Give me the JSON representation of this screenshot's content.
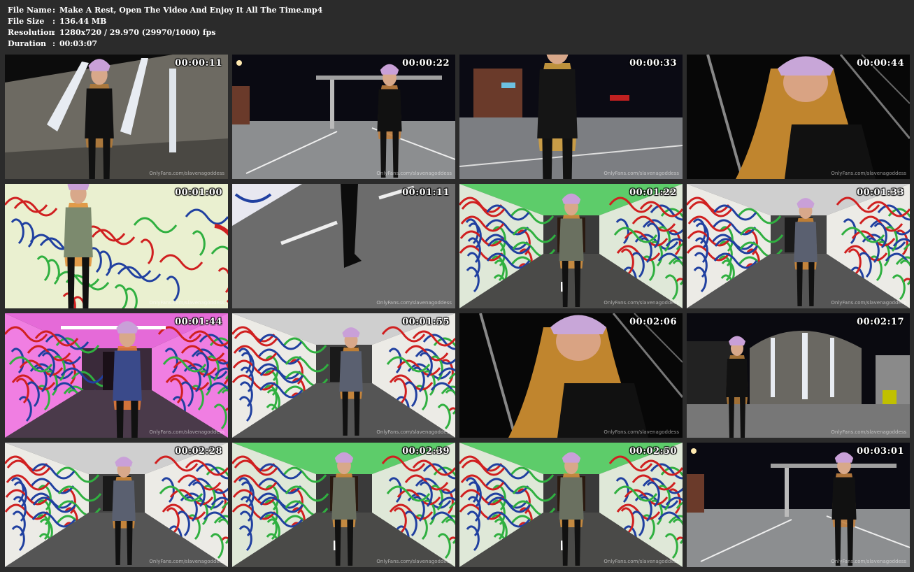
{
  "file_info": {
    "file_name_label": "File Name",
    "file_name": "Make A Rest, Open The Video And Enjoy It All The Time.mp4",
    "file_size_label": "File Size",
    "file_size": "136.44 MB",
    "resolution_label": "Resolution",
    "resolution": "1280x720 / 29.970 (29970/1000) fps",
    "duration_label": "Duration",
    "duration": "00:03:07",
    "separator": ":"
  },
  "watermark": "OnlyFans.com/slavenagoddess",
  "thumbnails": [
    {
      "time": "00:00:11",
      "scene": "night-building"
    },
    {
      "time": "00:00:22",
      "scene": "night-parking"
    },
    {
      "time": "00:00:33",
      "scene": "night-parking-blur"
    },
    {
      "time": "00:00:44",
      "scene": "night-closeup"
    },
    {
      "time": "00:01:00",
      "scene": "graffiti-wall"
    },
    {
      "time": "00:01:11",
      "scene": "boots-road"
    },
    {
      "time": "00:01:22",
      "scene": "tunnel-green"
    },
    {
      "time": "00:01:33",
      "scene": "tunnel-white"
    },
    {
      "time": "00:01:44",
      "scene": "tunnel-pink"
    },
    {
      "time": "00:01:55",
      "scene": "tunnel-white"
    },
    {
      "time": "00:02:06",
      "scene": "night-closeup"
    },
    {
      "time": "00:02:17",
      "scene": "night-building-round"
    },
    {
      "time": "00:02:28",
      "scene": "tunnel-white"
    },
    {
      "time": "00:02:39",
      "scene": "tunnel-green"
    },
    {
      "time": "00:02:50",
      "scene": "tunnel-green"
    },
    {
      "time": "00:03:01",
      "scene": "night-parking"
    }
  ]
}
